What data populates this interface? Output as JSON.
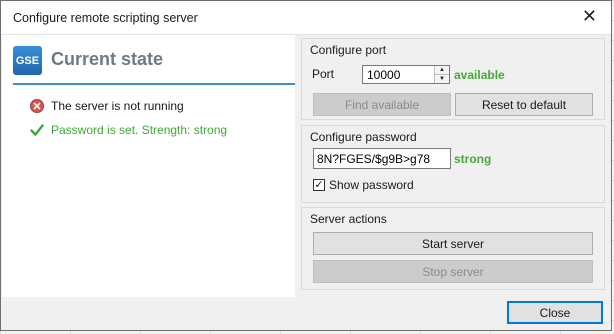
{
  "window": {
    "title": "Configure remote scripting server"
  },
  "current_state": {
    "logo_text": "GSE",
    "title": "Current state",
    "items": [
      {
        "text": "The server is not running",
        "icon": "error-icon",
        "color": "#d9534f"
      },
      {
        "text": "Password is set. Strength: strong",
        "icon": "check-icon",
        "color": "#3fa63a"
      }
    ]
  },
  "configure_port": {
    "group_label": "Configure port",
    "port_label": "Port",
    "port_value": "10000",
    "status": "available",
    "find_button": "Find available",
    "reset_button": "Reset to default"
  },
  "configure_password": {
    "group_label": "Configure password",
    "password_value": "8N?FGES/$g9B>g78",
    "strength": "strong",
    "show_password_label": "Show password",
    "show_password_checked": true
  },
  "server_actions": {
    "group_label": "Server actions",
    "start_button": "Start server",
    "stop_button": "Stop server"
  },
  "footer": {
    "close_button": "Close"
  },
  "colors": {
    "accent": "#3c8fce",
    "good": "#4aa83a",
    "error": "#d9534f"
  }
}
